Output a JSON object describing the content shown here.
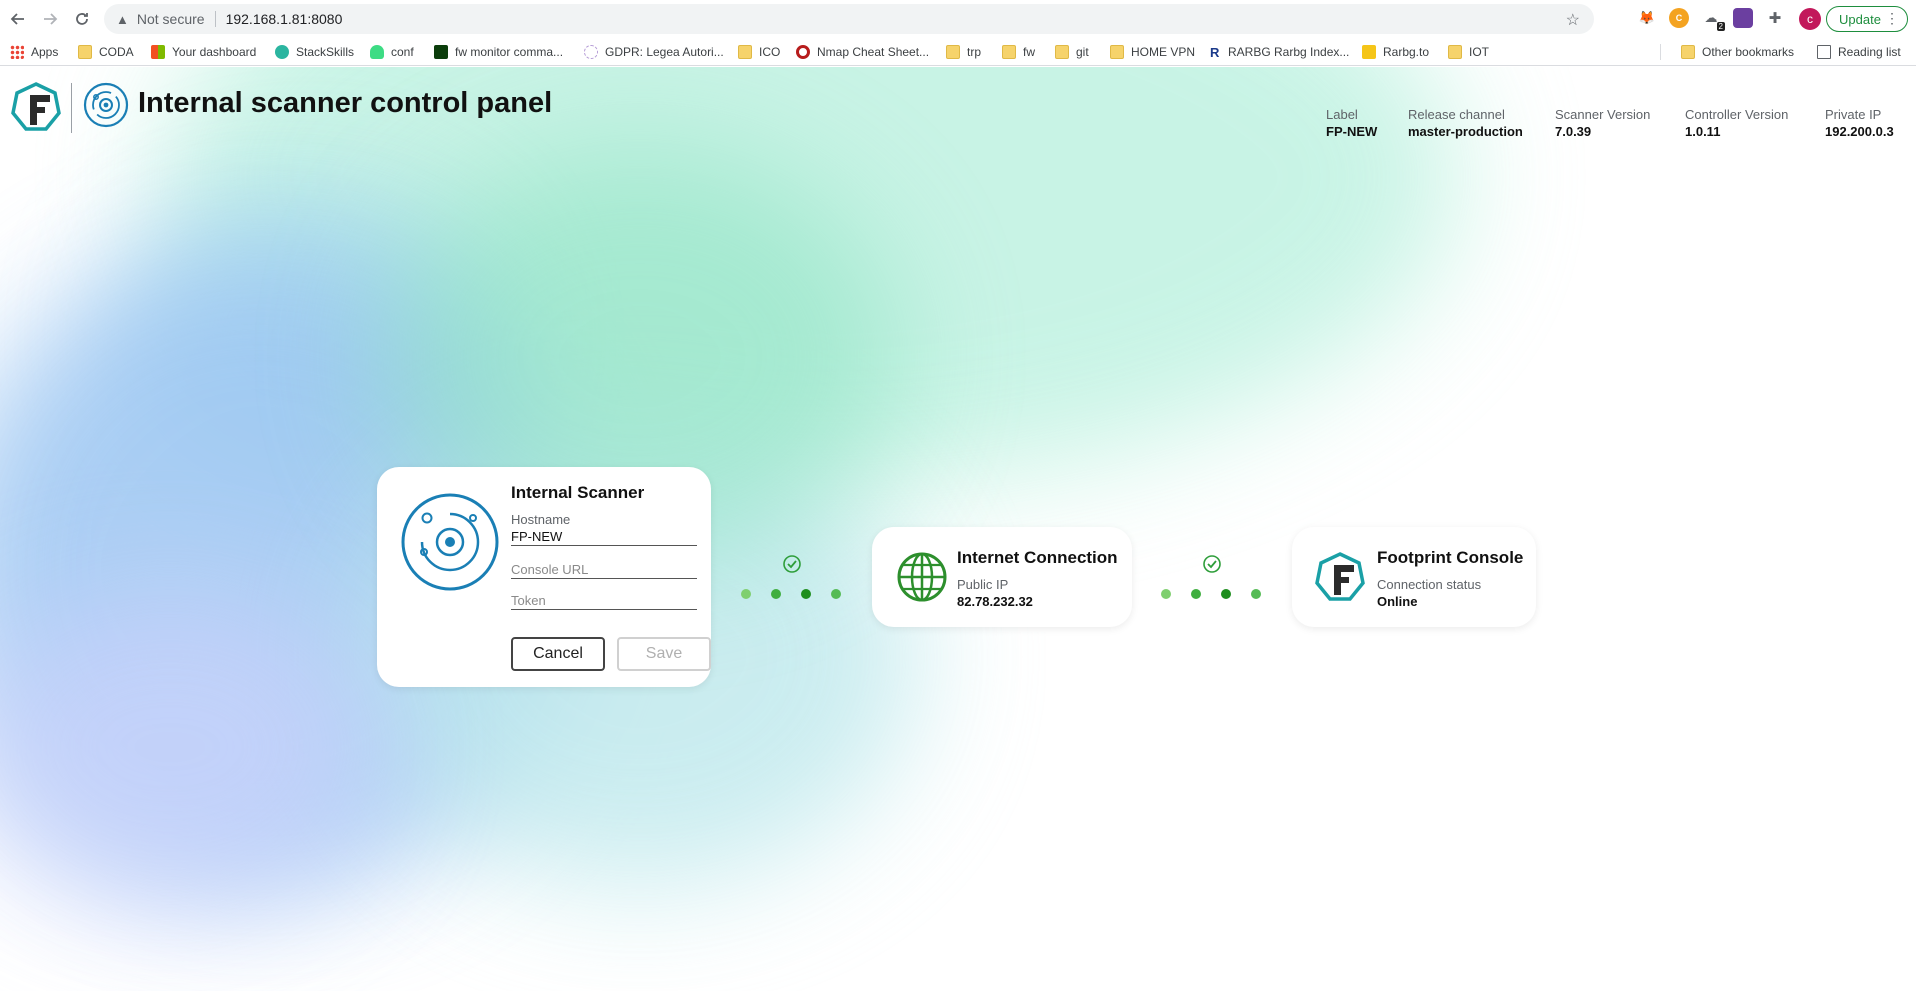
{
  "browser": {
    "url_warning": "Not secure",
    "url": "192.168.1.81:8080",
    "profile_initial": "c",
    "update_label": "Update",
    "extension_badge": "2",
    "bookmarks": [
      {
        "label": "Apps",
        "icon": "apps-grid-icon"
      },
      {
        "label": "CODA",
        "icon": "folder-icon"
      },
      {
        "label": "Your dashboard",
        "icon": "microsoft-icon"
      },
      {
        "label": "StackSkills",
        "icon": "stackskills-icon"
      },
      {
        "label": "conf",
        "icon": "android-icon"
      },
      {
        "label": "fw monitor comma...",
        "icon": "terminal-icon"
      },
      {
        "label": "GDPR: Legea Autori...",
        "icon": "gdpr-icon"
      },
      {
        "label": "ICO",
        "icon": "folder-icon"
      },
      {
        "label": "Nmap Cheat Sheet...",
        "icon": "target-icon"
      },
      {
        "label": "trp",
        "icon": "folder-icon"
      },
      {
        "label": "fw",
        "icon": "folder-icon"
      },
      {
        "label": "git",
        "icon": "folder-icon"
      },
      {
        "label": "HOME VPN",
        "icon": "folder-icon"
      },
      {
        "label": "RARBG Rarbg Index...",
        "icon": "rarbg-icon"
      },
      {
        "label": "Rarbg.to",
        "icon": "imdb-icon"
      },
      {
        "label": "IOT",
        "icon": "folder-icon"
      }
    ],
    "other_bookmarks": "Other bookmarks",
    "reading_list": "Reading list"
  },
  "header": {
    "title": "Internal scanner control panel",
    "meta": [
      {
        "key": "Label",
        "value": "FP-NEW"
      },
      {
        "key": "Release channel",
        "value": "master-production"
      },
      {
        "key": "Scanner Version",
        "value": "7.0.39"
      },
      {
        "key": "Controller Version",
        "value": "1.0.11"
      },
      {
        "key": "Private IP",
        "value": "192.200.0.3"
      }
    ]
  },
  "scanner_card": {
    "title": "Internal Scanner",
    "hostname_label": "Hostname",
    "hostname_value": "FP-NEW",
    "console_url_placeholder": "Console URL",
    "token_placeholder": "Token",
    "cancel_label": "Cancel",
    "save_label": "Save"
  },
  "internet_card": {
    "title": "Internet Connection",
    "label": "Public IP",
    "value": "82.78.232.32"
  },
  "console_card": {
    "title": "Footprint Console",
    "label": "Connection status",
    "value": "Online"
  },
  "colors": {
    "brand_blue": "#1a7fb5",
    "brand_teal": "#1aa0a6",
    "success_green": "#2e9e3a",
    "globe_green": "#2d8f2d"
  }
}
